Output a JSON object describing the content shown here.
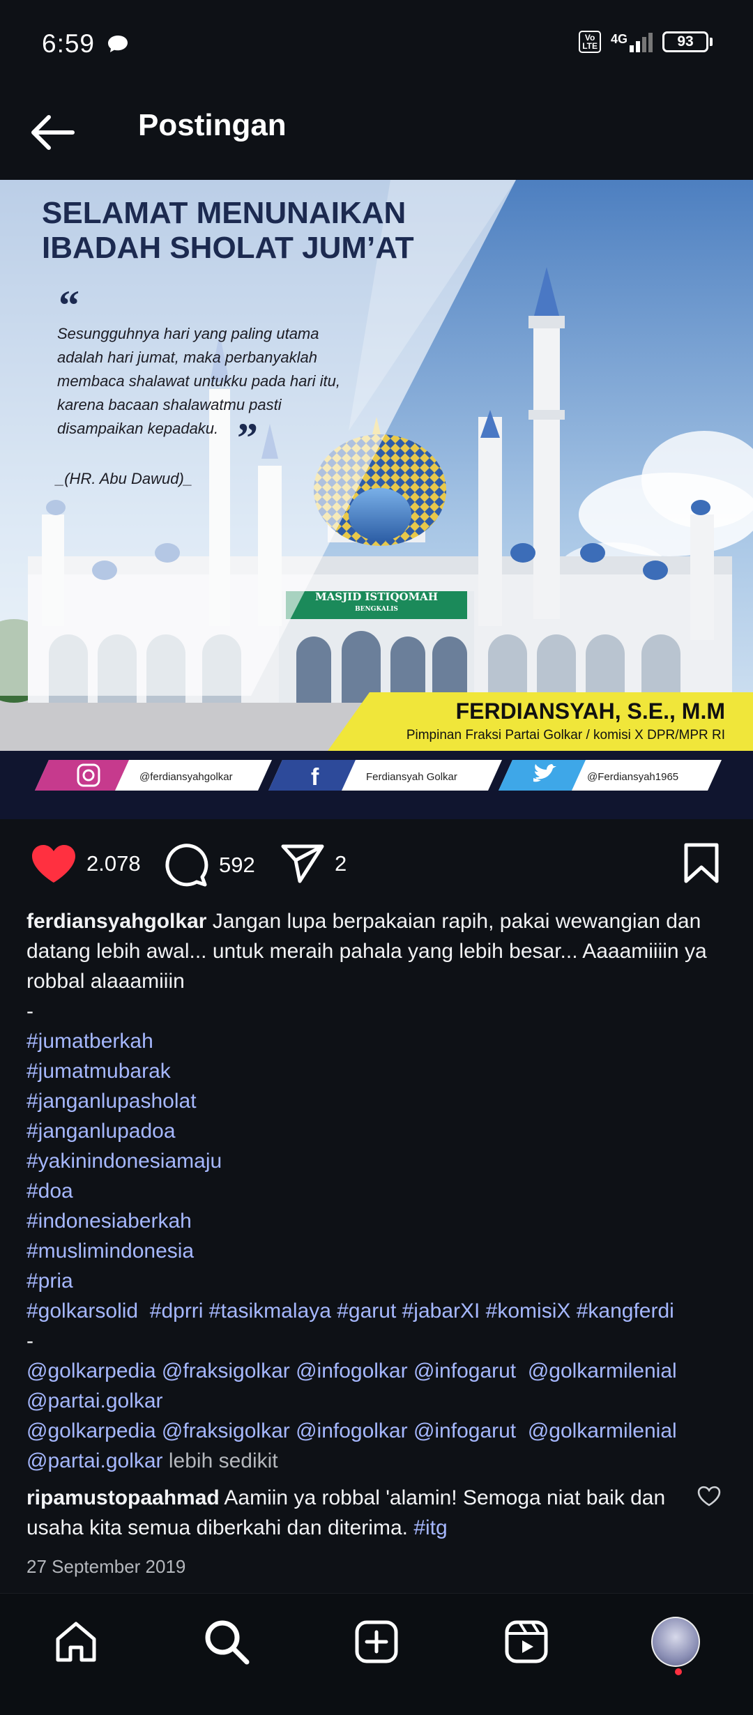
{
  "status_bar": {
    "time": "6:59",
    "volte": "Vo LTE",
    "network": "4G",
    "battery": "93"
  },
  "header": {
    "title": "Postingan"
  },
  "post_image": {
    "headline_line1": "SELAMAT MENUNAIKAN",
    "headline_line2": "IBADAH SHOLAT JUM’AT",
    "quote_lines": [
      "Sesungguhnya hari yang paling utama",
      "adalah hari jumat, maka perbanyaklah",
      "membaca shalawat untukku pada hari itu,",
      "karena bacaan shalawatmu pasti",
      "disampaikan kepadaku."
    ],
    "quote_source": "_(HR. Abu Dawud)_",
    "mosque_sign": "MASJID ISTIQOMAH",
    "mosque_sign_sub": "BENGKALIS",
    "name": "FERDIANSYAH, S.E., M.M",
    "position": "Pimpinan Fraksi Partai Golkar / komisi X DPR/MPR RI",
    "socials": [
      {
        "icon": "instagram-icon",
        "handle": "@ferdiansyahgolkar"
      },
      {
        "icon": "facebook-icon",
        "handle": "Ferdiansyah Golkar"
      },
      {
        "icon": "twitter-icon",
        "handle": "@Ferdiansyah1965"
      }
    ],
    "colors": {
      "sky_top": "#5b88c4",
      "sky_bottom": "#cfe0f0",
      "yellow": "#f0e63a",
      "dark_band": "#10152f",
      "green_sign": "#1b8a5a"
    }
  },
  "actions": {
    "likes": "2.078",
    "comments": "592",
    "shares": "2",
    "like_color": "#ff3040"
  },
  "caption": {
    "username": "ferdiansyahgolkar",
    "text": "Jangan lupa berpakaian rapih, pakai wewangian dan datang lebih awal... untuk meraih pahala yang lebih besar... Aaaamiiiin ya robbal alaaamiiin",
    "separator1": "-",
    "hashtags": [
      "#jumatberkah",
      "#jumatmubarak",
      "#janganlupasholat",
      "#janganlupadoa",
      "#yakinindonesiamaju",
      "#doa",
      "#indonesiaberkah",
      "#muslimindonesia",
      "#pria"
    ],
    "hashtag_line": "#golkarsolid  #dprri #tasikmalaya #garut #jabarXI #komisiX #kangferdi",
    "separator2": "-",
    "mentions_line1": "@golkarpedia @fraksigolkar @infogolkar @infogarut  @golkarmilenial",
    "mentions_line2": "@partai.golkar",
    "mentions_line3": "@golkarpedia @fraksigolkar @infogolkar @infogarut  @golkarmilenial",
    "mentions_line4": "@partai.golkar",
    "more": "lebih sedikit"
  },
  "comment": {
    "username": "ripamustopaahmad",
    "text": "Aamiin ya robbal 'alamin! Semoga niat baik dan usaha kita semua diberkahi dan diterima.",
    "tag": "#itg"
  },
  "date": "27 September 2019",
  "nav": [
    "home-icon",
    "search-icon",
    "create-icon",
    "reels-icon",
    "profile-avatar"
  ]
}
